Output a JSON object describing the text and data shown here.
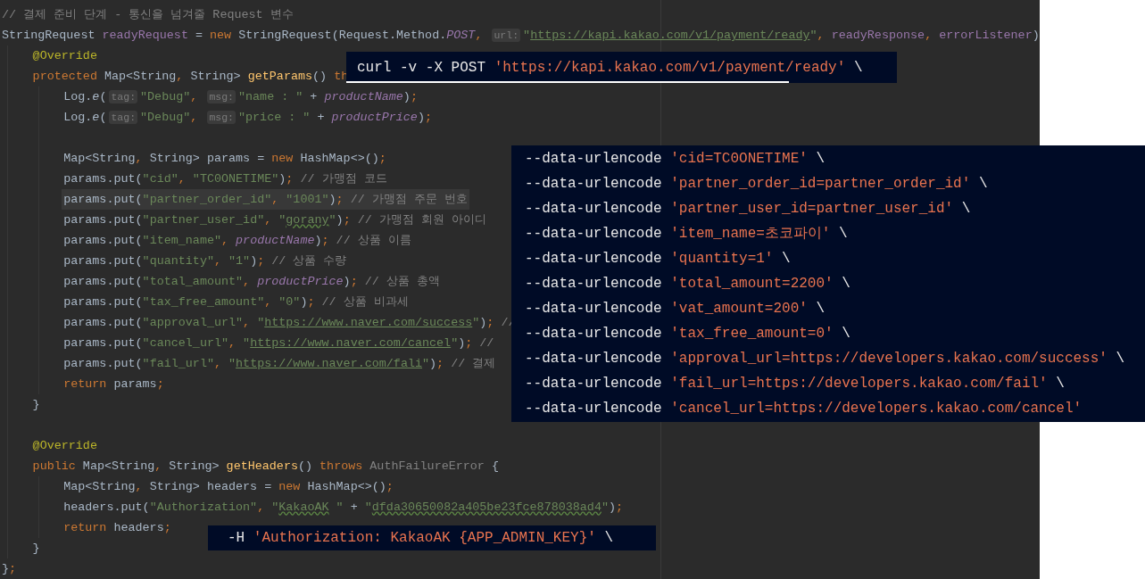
{
  "editor": {
    "lines": [
      {
        "kind": "code",
        "current": false,
        "tokens": [
          {
            "kind": "comment",
            "text": "// 결제 준비 단계 - 통신을 넘겨줄 Request 변수"
          }
        ]
      },
      {
        "kind": "code",
        "current": false,
        "tokens": [
          {
            "kind": "plain",
            "text": "StringRequest "
          },
          {
            "kind": "field",
            "text": "readyRequest"
          },
          {
            "kind": "plain",
            "text": " = "
          },
          {
            "kind": "keyword",
            "text": "new"
          },
          {
            "kind": "plain",
            "text": " StringRequest(Request.Method."
          },
          {
            "kind": "static",
            "text": "POST"
          },
          {
            "kind": "keyword",
            "text": ", "
          },
          {
            "kind": "hint",
            "text": "url:"
          },
          {
            "kind": "string",
            "text": "\""
          },
          {
            "kind": "link",
            "text": "https://kapi.kakao.com/v1/payment/ready"
          },
          {
            "kind": "string",
            "text": "\""
          },
          {
            "kind": "keyword",
            "text": ", "
          },
          {
            "kind": "field",
            "text": "readyResponse"
          },
          {
            "kind": "keyword",
            "text": ", "
          },
          {
            "kind": "field",
            "text": "errorListener"
          },
          {
            "kind": "plain",
            "text": ")"
          }
        ],
        "children": [
          {
            "kind": "code",
            "current": false,
            "tokens": [
              {
                "kind": "annotation",
                "text": "@Override"
              }
            ]
          },
          {
            "kind": "code",
            "current": false,
            "tokens": [
              {
                "kind": "keyword",
                "text": "protected"
              },
              {
                "kind": "plain",
                "text": " Map<String"
              },
              {
                "kind": "keyword",
                "text": ", "
              },
              {
                "kind": "plain",
                "text": "String> "
              },
              {
                "kind": "method",
                "text": "getParams"
              },
              {
                "kind": "plain",
                "text": "() "
              },
              {
                "kind": "keyword",
                "text": "th"
              }
            ],
            "children": [
              {
                "kind": "code",
                "current": false,
                "tokens": [
                  {
                    "kind": "plain",
                    "text": "Log."
                  },
                  {
                    "kind": "italic",
                    "text": "e"
                  },
                  {
                    "kind": "plain",
                    "text": "("
                  },
                  {
                    "kind": "hint",
                    "text": "tag:"
                  },
                  {
                    "kind": "string",
                    "text": "\"Debug\""
                  },
                  {
                    "kind": "keyword",
                    "text": ", "
                  },
                  {
                    "kind": "hint",
                    "text": "msg:"
                  },
                  {
                    "kind": "string",
                    "text": "\"name : \""
                  },
                  {
                    "kind": "plain",
                    "text": " + "
                  },
                  {
                    "kind": "static",
                    "text": "productName"
                  },
                  {
                    "kind": "plain",
                    "text": ")"
                  },
                  {
                    "kind": "keyword",
                    "text": ";"
                  }
                ]
              },
              {
                "kind": "code",
                "current": false,
                "tokens": [
                  {
                    "kind": "plain",
                    "text": "Log."
                  },
                  {
                    "kind": "italic",
                    "text": "e"
                  },
                  {
                    "kind": "plain",
                    "text": "("
                  },
                  {
                    "kind": "hint",
                    "text": "tag:"
                  },
                  {
                    "kind": "string",
                    "text": "\"Debug\""
                  },
                  {
                    "kind": "keyword",
                    "text": ", "
                  },
                  {
                    "kind": "hint",
                    "text": "msg:"
                  },
                  {
                    "kind": "string",
                    "text": "\"price : \""
                  },
                  {
                    "kind": "plain",
                    "text": " + "
                  },
                  {
                    "kind": "static",
                    "text": "productPrice"
                  },
                  {
                    "kind": "plain",
                    "text": ")"
                  },
                  {
                    "kind": "keyword",
                    "text": ";"
                  }
                ]
              },
              {
                "kind": "blank"
              },
              {
                "kind": "code",
                "current": false,
                "tokens": [
                  {
                    "kind": "plain",
                    "text": "Map<String"
                  },
                  {
                    "kind": "keyword",
                    "text": ", "
                  },
                  {
                    "kind": "plain",
                    "text": "String> params = "
                  },
                  {
                    "kind": "keyword",
                    "text": "new"
                  },
                  {
                    "kind": "plain",
                    "text": " HashMap<>()"
                  },
                  {
                    "kind": "keyword",
                    "text": ";"
                  }
                ]
              },
              {
                "kind": "code",
                "current": false,
                "tokens": [
                  {
                    "kind": "plain",
                    "text": "params.put("
                  },
                  {
                    "kind": "string",
                    "text": "\"cid\""
                  },
                  {
                    "kind": "keyword",
                    "text": ", "
                  },
                  {
                    "kind": "string",
                    "text": "\"TC0ONETIME\""
                  },
                  {
                    "kind": "plain",
                    "text": ")"
                  },
                  {
                    "kind": "keyword",
                    "text": ";"
                  },
                  {
                    "kind": "comment",
                    "text": " // 가맹점 코드"
                  }
                ]
              },
              {
                "kind": "code",
                "current": true,
                "tokens": [
                  {
                    "kind": "plain",
                    "text": "params.put("
                  },
                  {
                    "kind": "string",
                    "text": "\"partner_order_id\""
                  },
                  {
                    "kind": "keyword",
                    "text": ", "
                  },
                  {
                    "kind": "string",
                    "text": "\"1001\""
                  },
                  {
                    "kind": "plain",
                    "text": ")"
                  },
                  {
                    "kind": "keyword",
                    "text": ";"
                  },
                  {
                    "kind": "comment",
                    "text": " // 가맹점 주문 번호"
                  }
                ]
              },
              {
                "kind": "code",
                "current": false,
                "tokens": [
                  {
                    "kind": "plain",
                    "text": "params.put("
                  },
                  {
                    "kind": "string",
                    "text": "\"partner_user_id\""
                  },
                  {
                    "kind": "keyword",
                    "text": ", "
                  },
                  {
                    "kind": "string",
                    "text": "\""
                  },
                  {
                    "kind": "typo",
                    "text": "gorany"
                  },
                  {
                    "kind": "string",
                    "text": "\""
                  },
                  {
                    "kind": "plain",
                    "text": ")"
                  },
                  {
                    "kind": "keyword",
                    "text": ";"
                  },
                  {
                    "kind": "comment",
                    "text": " // 가맹점 회원 아이디"
                  }
                ]
              },
              {
                "kind": "code",
                "current": false,
                "tokens": [
                  {
                    "kind": "plain",
                    "text": "params.put("
                  },
                  {
                    "kind": "string",
                    "text": "\"item_name\""
                  },
                  {
                    "kind": "keyword",
                    "text": ", "
                  },
                  {
                    "kind": "static",
                    "text": "productName"
                  },
                  {
                    "kind": "plain",
                    "text": ")"
                  },
                  {
                    "kind": "keyword",
                    "text": ";"
                  },
                  {
                    "kind": "comment",
                    "text": " // 상품 이름"
                  }
                ]
              },
              {
                "kind": "code",
                "current": false,
                "tokens": [
                  {
                    "kind": "plain",
                    "text": "params.put("
                  },
                  {
                    "kind": "string",
                    "text": "\"quantity\""
                  },
                  {
                    "kind": "keyword",
                    "text": ", "
                  },
                  {
                    "kind": "string",
                    "text": "\"1\""
                  },
                  {
                    "kind": "plain",
                    "text": ")"
                  },
                  {
                    "kind": "keyword",
                    "text": ";"
                  },
                  {
                    "kind": "comment",
                    "text": " // 상품 수량"
                  }
                ]
              },
              {
                "kind": "code",
                "current": false,
                "tokens": [
                  {
                    "kind": "plain",
                    "text": "params.put("
                  },
                  {
                    "kind": "string",
                    "text": "\"total_amount\""
                  },
                  {
                    "kind": "keyword",
                    "text": ", "
                  },
                  {
                    "kind": "static",
                    "text": "productPrice"
                  },
                  {
                    "kind": "plain",
                    "text": ")"
                  },
                  {
                    "kind": "keyword",
                    "text": ";"
                  },
                  {
                    "kind": "comment",
                    "text": " // 상품 총액"
                  }
                ]
              },
              {
                "kind": "code",
                "current": false,
                "tokens": [
                  {
                    "kind": "plain",
                    "text": "params.put("
                  },
                  {
                    "kind": "string",
                    "text": "\"tax_free_amount\""
                  },
                  {
                    "kind": "keyword",
                    "text": ", "
                  },
                  {
                    "kind": "string",
                    "text": "\"0\""
                  },
                  {
                    "kind": "plain",
                    "text": ")"
                  },
                  {
                    "kind": "keyword",
                    "text": ";"
                  },
                  {
                    "kind": "comment",
                    "text": " // 상품 비과세"
                  }
                ]
              },
              {
                "kind": "code",
                "current": false,
                "tokens": [
                  {
                    "kind": "plain",
                    "text": "params.put("
                  },
                  {
                    "kind": "string",
                    "text": "\"approval_url\""
                  },
                  {
                    "kind": "keyword",
                    "text": ", "
                  },
                  {
                    "kind": "string",
                    "text": "\""
                  },
                  {
                    "kind": "link",
                    "text": "https://www.naver.com/success"
                  },
                  {
                    "kind": "string",
                    "text": "\""
                  },
                  {
                    "kind": "plain",
                    "text": ")"
                  },
                  {
                    "kind": "keyword",
                    "text": ";"
                  },
                  {
                    "kind": "comment",
                    "text": " //"
                  }
                ]
              },
              {
                "kind": "code",
                "current": false,
                "tokens": [
                  {
                    "kind": "plain",
                    "text": "params.put("
                  },
                  {
                    "kind": "string",
                    "text": "\"cancel_url\""
                  },
                  {
                    "kind": "keyword",
                    "text": ", "
                  },
                  {
                    "kind": "string",
                    "text": "\""
                  },
                  {
                    "kind": "link",
                    "text": "https://www.naver.com/cancel"
                  },
                  {
                    "kind": "string",
                    "text": "\""
                  },
                  {
                    "kind": "plain",
                    "text": ")"
                  },
                  {
                    "kind": "keyword",
                    "text": ";"
                  },
                  {
                    "kind": "comment",
                    "text": " //"
                  }
                ]
              },
              {
                "kind": "code",
                "current": false,
                "tokens": [
                  {
                    "kind": "plain",
                    "text": "params.put("
                  },
                  {
                    "kind": "string",
                    "text": "\"fail_url\""
                  },
                  {
                    "kind": "keyword",
                    "text": ", "
                  },
                  {
                    "kind": "string",
                    "text": "\""
                  },
                  {
                    "kind": "link",
                    "text": "https://www.naver.com/fali"
                  },
                  {
                    "kind": "string",
                    "text": "\""
                  },
                  {
                    "kind": "plain",
                    "text": ")"
                  },
                  {
                    "kind": "keyword",
                    "text": ";"
                  },
                  {
                    "kind": "comment",
                    "text": " // 결제"
                  }
                ]
              },
              {
                "kind": "code",
                "current": false,
                "tokens": [
                  {
                    "kind": "keyword",
                    "text": "return"
                  },
                  {
                    "kind": "plain",
                    "text": " params"
                  },
                  {
                    "kind": "keyword",
                    "text": ";"
                  }
                ]
              }
            ]
          },
          {
            "kind": "code",
            "current": false,
            "tokens": [
              {
                "kind": "plain",
                "text": "}"
              }
            ]
          },
          {
            "kind": "blank"
          },
          {
            "kind": "code",
            "current": false,
            "tokens": [
              {
                "kind": "annotation",
                "text": "@Override"
              }
            ]
          },
          {
            "kind": "code",
            "current": false,
            "tokens": [
              {
                "kind": "keyword",
                "text": "public"
              },
              {
                "kind": "plain",
                "text": " Map<String"
              },
              {
                "kind": "keyword",
                "text": ", "
              },
              {
                "kind": "plain",
                "text": "String> "
              },
              {
                "kind": "method",
                "text": "getHeaders"
              },
              {
                "kind": "plain",
                "text": "() "
              },
              {
                "kind": "keyword",
                "text": "throws"
              },
              {
                "kind": "muted",
                "text": " AuthFailureError"
              },
              {
                "kind": "plain",
                "text": " {"
              }
            ],
            "children": [
              {
                "kind": "code",
                "current": false,
                "tokens": [
                  {
                    "kind": "plain",
                    "text": "Map<String"
                  },
                  {
                    "kind": "keyword",
                    "text": ", "
                  },
                  {
                    "kind": "plain",
                    "text": "String> headers = "
                  },
                  {
                    "kind": "keyword",
                    "text": "new"
                  },
                  {
                    "kind": "plain",
                    "text": " HashMap<>()"
                  },
                  {
                    "kind": "keyword",
                    "text": ";"
                  }
                ]
              },
              {
                "kind": "code",
                "current": false,
                "tokens": [
                  {
                    "kind": "plain",
                    "text": "headers.put("
                  },
                  {
                    "kind": "string",
                    "text": "\"Authorization\""
                  },
                  {
                    "kind": "keyword",
                    "text": ", "
                  },
                  {
                    "kind": "string",
                    "text": "\""
                  },
                  {
                    "kind": "typo",
                    "text": "KakaoAK"
                  },
                  {
                    "kind": "string",
                    "text": " \""
                  },
                  {
                    "kind": "plain",
                    "text": " + "
                  },
                  {
                    "kind": "string",
                    "text": "\""
                  },
                  {
                    "kind": "typo",
                    "text": "dfda30650082a405be23fce878038ad4"
                  },
                  {
                    "kind": "string",
                    "text": "\""
                  },
                  {
                    "kind": "plain",
                    "text": ")"
                  },
                  {
                    "kind": "keyword",
                    "text": ";"
                  }
                ]
              },
              {
                "kind": "code",
                "current": false,
                "tokens": [
                  {
                    "kind": "keyword",
                    "text": "return"
                  },
                  {
                    "kind": "plain",
                    "text": " headers"
                  },
                  {
                    "kind": "keyword",
                    "text": ";"
                  }
                ]
              }
            ]
          },
          {
            "kind": "code",
            "current": false,
            "tokens": [
              {
                "kind": "plain",
                "text": "}"
              }
            ]
          }
        ]
      },
      {
        "kind": "code",
        "current": false,
        "tokens": [
          {
            "kind": "plain",
            "text": "}"
          },
          {
            "kind": "keyword",
            "text": ";"
          }
        ]
      }
    ]
  },
  "snippets": [
    {
      "lines": [
        {
          "option": "curl -v -X POST",
          "value": "'https://kapi.kakao.com/v1/payment/ready'",
          "continuation": "\\"
        }
      ]
    },
    {
      "lines": [
        {
          "option": "--data-urlencode",
          "value": "'cid=TC0ONETIME'",
          "continuation": "\\"
        },
        {
          "option": "--data-urlencode",
          "value": "'partner_order_id=partner_order_id'",
          "continuation": "\\"
        },
        {
          "option": "--data-urlencode",
          "value": "'partner_user_id=partner_user_id'",
          "continuation": "\\"
        },
        {
          "option": "--data-urlencode",
          "value": "'item_name=초코파이'",
          "continuation": "\\"
        },
        {
          "option": "--data-urlencode",
          "value": "'quantity=1'",
          "continuation": "\\"
        },
        {
          "option": "--data-urlencode",
          "value": "'total_amount=2200'",
          "continuation": "\\"
        },
        {
          "option": "--data-urlencode",
          "value": "'vat_amount=200'",
          "continuation": "\\"
        },
        {
          "option": "--data-urlencode",
          "value": "'tax_free_amount=0'",
          "continuation": "\\"
        },
        {
          "option": "--data-urlencode",
          "value": "'approval_url=https://developers.kakao.com/success'",
          "continuation": "\\"
        },
        {
          "option": "--data-urlencode",
          "value": "'fail_url=https://developers.kakao.com/fail'",
          "continuation": "\\"
        },
        {
          "option": "--data-urlencode",
          "value": "'cancel_url=https://developers.kakao.com/cancel'"
        }
      ]
    },
    {
      "lines": [
        {
          "option": "-H",
          "value": "'Authorization: KakaoAK {APP_ADMIN_KEY}'",
          "continuation": "\\"
        }
      ]
    }
  ]
}
